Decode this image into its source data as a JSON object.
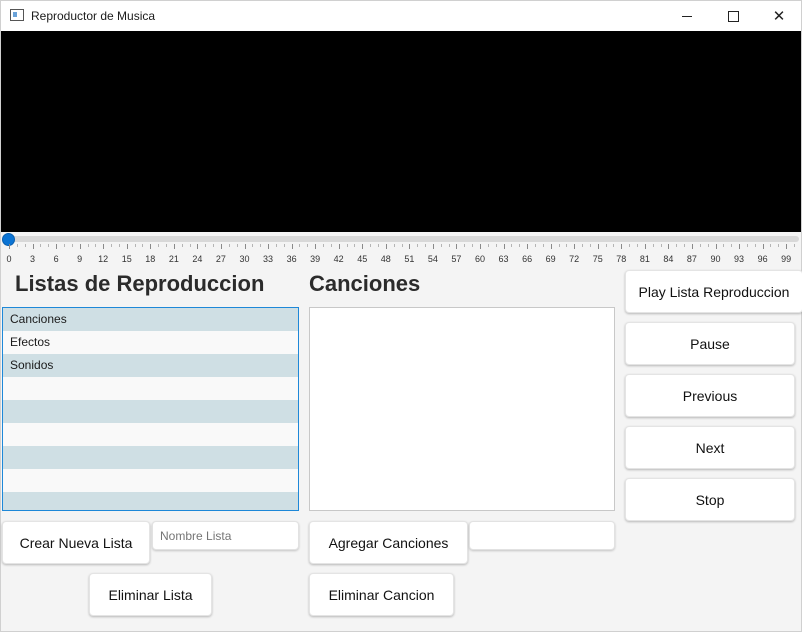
{
  "window": {
    "title": "Reproductor de Musica"
  },
  "slider": {
    "value_percent": 0,
    "tick_labels": [
      "0",
      "3",
      "6",
      "9",
      "12",
      "15",
      "18",
      "21",
      "24",
      "27",
      "30",
      "33",
      "36",
      "39",
      "42",
      "45",
      "48",
      "51",
      "54",
      "57",
      "60",
      "63",
      "66",
      "69",
      "72",
      "75",
      "78",
      "81",
      "84",
      "87",
      "90",
      "93",
      "96",
      "99"
    ]
  },
  "playlists": {
    "heading": "Listas de Reproduccion",
    "items": [
      "Canciones",
      "Efectos",
      "Sonidos"
    ],
    "create_label": "Crear Nueva Lista",
    "name_placeholder": "Nombre Lista",
    "delete_label": "Eliminar Lista"
  },
  "songs": {
    "heading": "Canciones",
    "add_label": "Agregar Canciones",
    "add_field_value": "",
    "delete_label": "Eliminar Cancion"
  },
  "controls": {
    "play_list_label": "Play Lista Reproduccion",
    "pause_label": "Pause",
    "previous_label": "Previous",
    "next_label": "Next",
    "stop_label": "Stop"
  },
  "colors": {
    "thumb": "#0b74d4",
    "list_selected_border": "#1e88d8",
    "list_odd_row": "#cfdfe4"
  }
}
